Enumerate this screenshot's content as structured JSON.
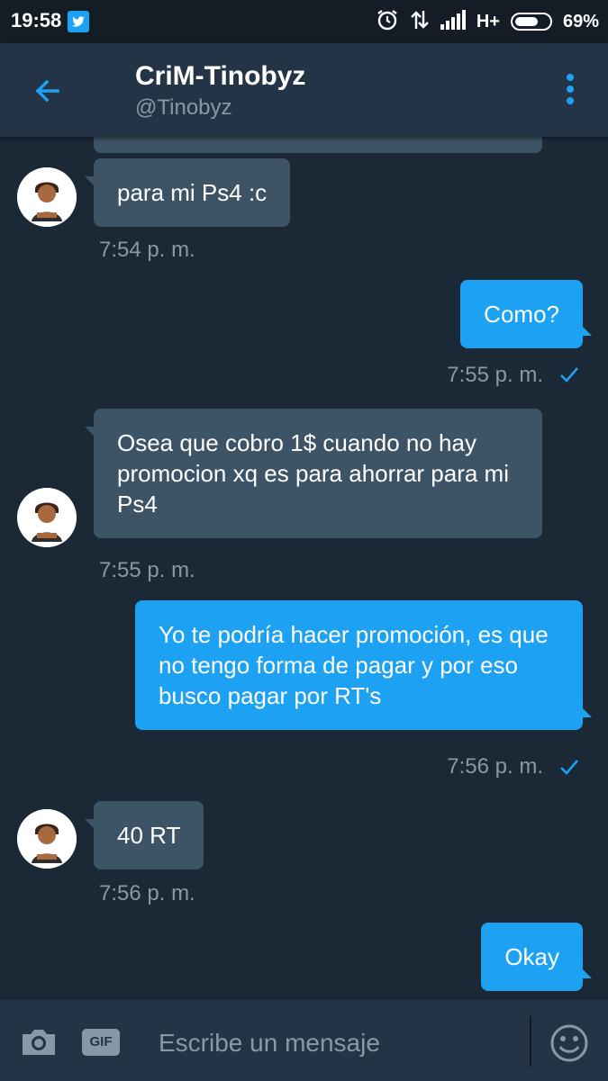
{
  "status_bar": {
    "time": "19:58",
    "network": "H+",
    "battery_percent": "69%",
    "battery_level": 0.69,
    "icons": [
      "twitter-icon",
      "alarm-icon",
      "data-transfer-icon",
      "signal-icon",
      "battery-icon"
    ]
  },
  "header": {
    "name": "CriM-Tinobyz",
    "handle": "@Tinobyz",
    "accent": "#1da1f2"
  },
  "messages": [
    {
      "direction": "incoming",
      "text": "para mi Ps4 :c",
      "time": "7:54 p. m."
    },
    {
      "direction": "outgoing",
      "text": "Como?",
      "time": "7:55 p. m."
    },
    {
      "direction": "incoming",
      "text": "Osea que cobro 1$ cuando no hay promocion xq es para ahorrar para mi Ps4",
      "time": "7:55 p. m."
    },
    {
      "direction": "outgoing",
      "text": "Yo te podría hacer promoción, es que no tengo forma de pagar y por eso busco pagar por RT's",
      "time": "7:56 p. m."
    },
    {
      "direction": "incoming",
      "text": "40 RT",
      "time": "7:56 p. m."
    },
    {
      "direction": "outgoing",
      "text": "Okay",
      "time": ""
    }
  ],
  "compose": {
    "placeholder": "Escribe un mensaje",
    "gif_label": "GIF"
  },
  "colors": {
    "background": "#1b2836",
    "incoming_bubble": "#3d5466",
    "outgoing_bubble": "#1da1f2",
    "secondary_text": "#8899a6"
  }
}
